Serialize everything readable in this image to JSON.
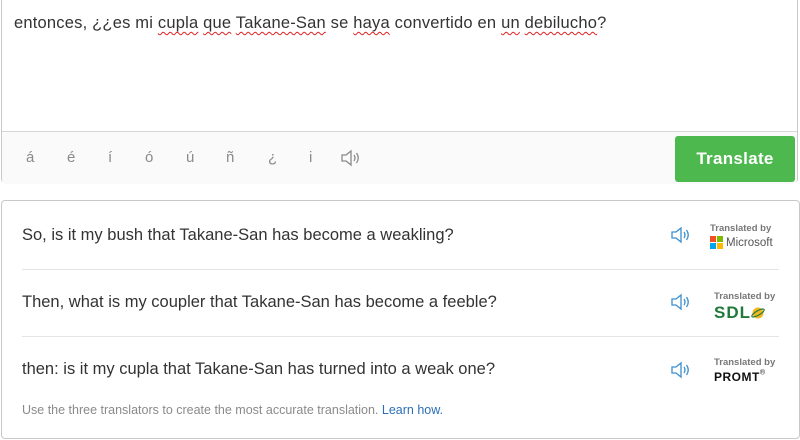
{
  "input": {
    "source_words": [
      "entonces, ¿¿es mi ",
      "cupla",
      " ",
      "que",
      " ",
      "Takane-San",
      " se ",
      "haya",
      " convertido en ",
      "un",
      " ",
      "debilucho",
      "?"
    ],
    "special_chars": [
      "á",
      "é",
      "í",
      "ó",
      "ú",
      "ñ",
      "¿",
      "i"
    ],
    "listen_icon": "speaker-icon",
    "translate_label": "Translate",
    "translate_color": "#4cb84e"
  },
  "results": [
    {
      "text": "So, is it my bush that Takane-San has become a weakling?",
      "caption": "Translated by",
      "provider": "Microsoft"
    },
    {
      "text": "Then, what is my coupler that Takane-San has become a feeble?",
      "caption": "Translated by",
      "provider": "SDL"
    },
    {
      "text": "then: is it my cupla that Takane-San has turned into a weak one?",
      "caption": "Translated by",
      "provider": "PROMT"
    }
  ],
  "footer": {
    "note": "Use the three translators to create the most accurate translation. ",
    "link": "Learn how."
  },
  "colors": {
    "speaker_blue": "#3a8fd0",
    "link_blue": "#2a6fb5",
    "sdl_green": "#1f7a3a"
  }
}
